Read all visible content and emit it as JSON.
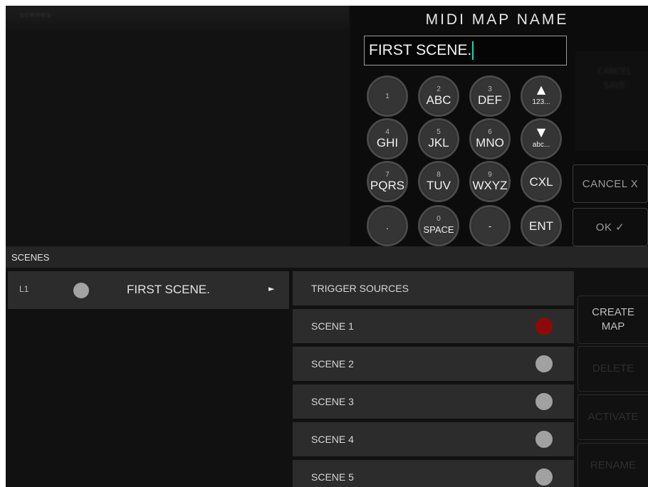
{
  "top_panel": {
    "title": "scenes"
  },
  "keyboard": {
    "title": "MIDI MAP NAME",
    "name_value": "FIRST SCENE.",
    "keys": [
      {
        "num": "1",
        "label": ""
      },
      {
        "num": "2",
        "label": "ABC"
      },
      {
        "num": "3",
        "label": "DEF"
      },
      {
        "icon": "up-arrow-icon",
        "glyph": "▲",
        "label": "123..."
      },
      {
        "num": "4",
        "label": "GHI"
      },
      {
        "num": "5",
        "label": "JKL"
      },
      {
        "num": "6",
        "label": "MNO"
      },
      {
        "icon": "down-arrow-icon",
        "glyph": "▼",
        "label": "abc..."
      },
      {
        "num": "7",
        "label": "PQRS"
      },
      {
        "num": "8",
        "label": "TUV"
      },
      {
        "num": "9",
        "label": "WXYZ"
      },
      {
        "num": "",
        "label": "CXL"
      },
      {
        "num": "",
        "label": "."
      },
      {
        "num": "0",
        "label": "SPACE"
      },
      {
        "num": "",
        "label": "-"
      },
      {
        "num": "",
        "label": "ENT"
      }
    ],
    "cancel_label": "CANCEL X",
    "ok_label": "OK ✓",
    "ghost_label_1": "CANCEL",
    "ghost_label_2": "SAVE"
  },
  "scenes": {
    "header": "SCENES",
    "items": [
      {
        "id": "L1",
        "name": "FIRST SCENE.",
        "arrow": "►"
      }
    ]
  },
  "triggers": {
    "header": "TRIGGER SOURCES",
    "items": [
      {
        "label": "SCENE 1",
        "status_color": "#8e0a0a"
      },
      {
        "label": "SCENE 2",
        "status_color": "#a1a1a1"
      },
      {
        "label": "SCENE 3",
        "status_color": "#a1a1a1"
      },
      {
        "label": "SCENE 4",
        "status_color": "#a1a1a1"
      },
      {
        "label": "SCENE 5",
        "status_color": "#a1a1a1"
      }
    ]
  },
  "actions": {
    "create_map": "CREATE MAP",
    "delete": "DELETE",
    "activate": "ACTIVATE",
    "rename": "RENAME"
  },
  "colors": {
    "caret": "#19d3b6",
    "active_trigger": "#8e0a0a",
    "inactive_trigger": "#a1a1a1"
  }
}
